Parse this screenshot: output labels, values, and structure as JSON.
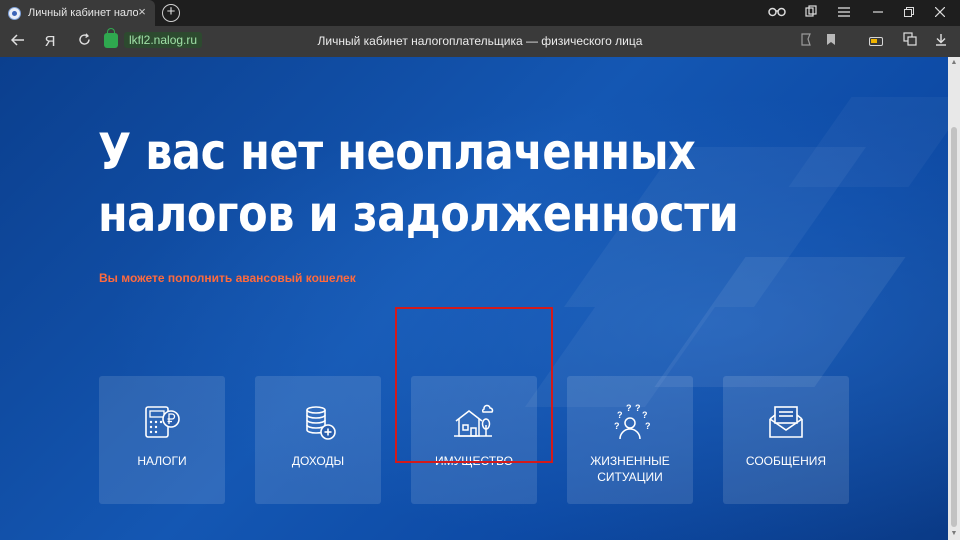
{
  "browser": {
    "tab_title": "Личный кабинет налогоплательщика",
    "tab_close": "×",
    "new_tab": "+",
    "address_domain": "lkfl2.nalog.ru",
    "page_title": "Личный кабинет налогоплательщика — физического лица",
    "yandex_button": "Я"
  },
  "main": {
    "headline_line1": "У вас нет неоплаченных",
    "headline_line2": "налогов и задолженности",
    "subline": "Вы можете пополнить авансовый кошелек"
  },
  "tiles": [
    {
      "label": "НАЛОГИ",
      "icon": "calculator-ruble-icon"
    },
    {
      "label": "ДОХОДЫ",
      "icon": "coins-plus-icon"
    },
    {
      "label": "ИМУЩЕСТВО",
      "icon": "house-tree-icon"
    },
    {
      "label_line1": "ЖИЗНЕННЫЕ",
      "label_line2": "СИТУАЦИИ",
      "icon": "person-questions-icon"
    },
    {
      "label": "СООБЩЕНИЯ",
      "icon": "envelope-letter-icon"
    }
  ],
  "colors": {
    "page_blue": "#1457b3",
    "accent_orange": "#ff6a3d",
    "highlight_red": "#d41a1a",
    "secure_green": "#2fa84f"
  }
}
